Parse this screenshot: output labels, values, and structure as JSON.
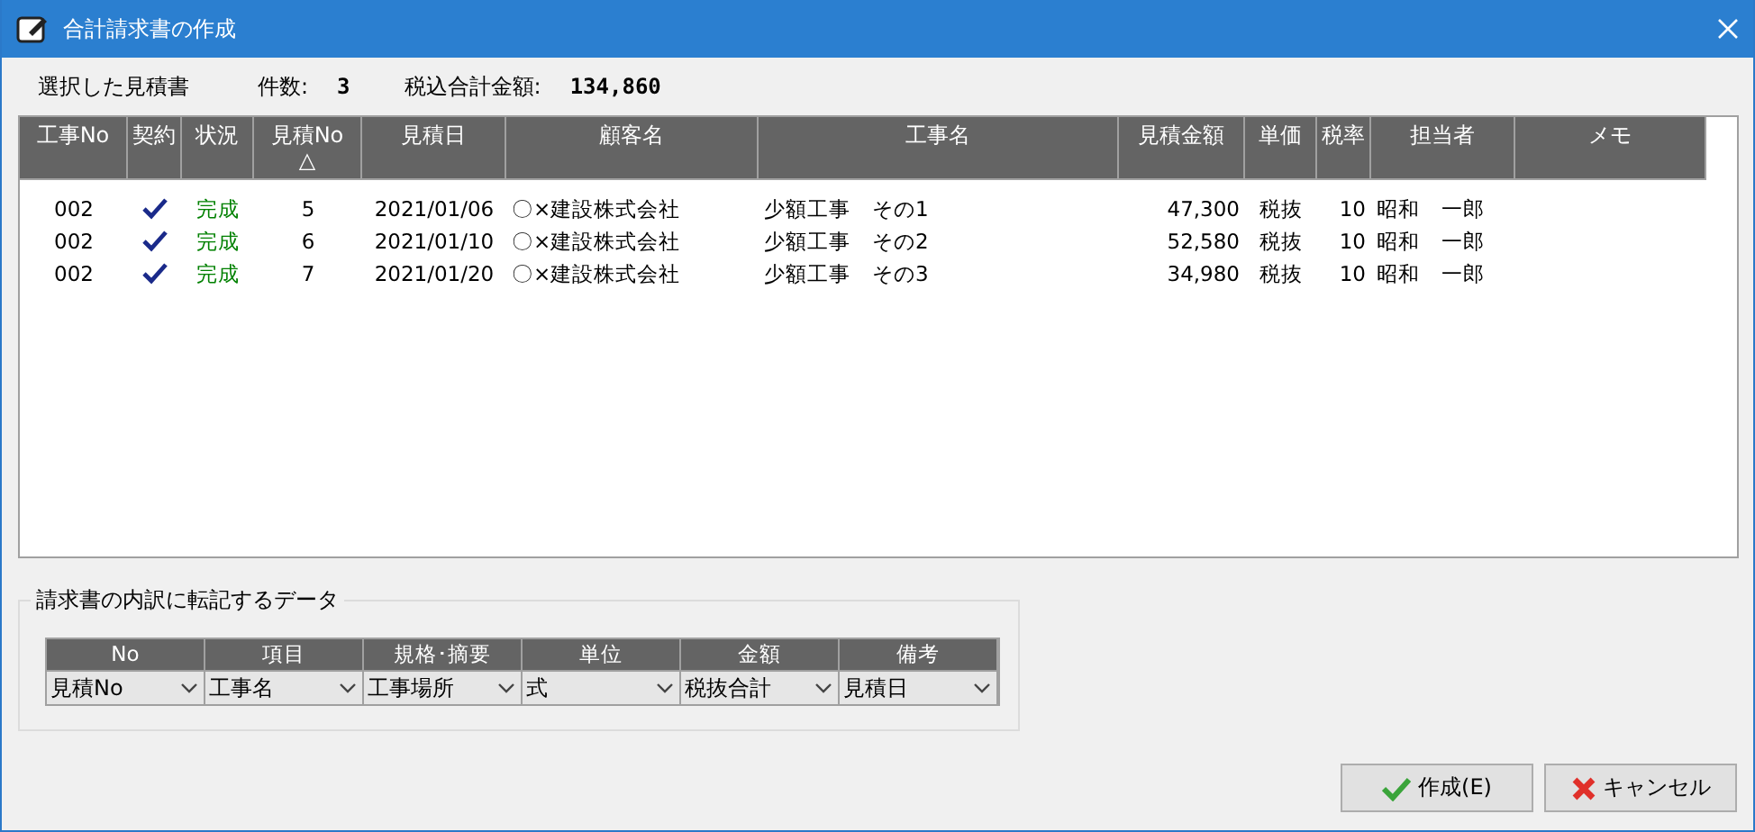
{
  "window": {
    "title": "合計請求書の作成"
  },
  "summary": {
    "label": "選択した見積書",
    "count_label": "件数:",
    "count": "3",
    "total_label": "税込合計金額:",
    "total": "134,860"
  },
  "table": {
    "columns": [
      {
        "label": "工事No"
      },
      {
        "label": "契約"
      },
      {
        "label": "状況"
      },
      {
        "label": "見積No",
        "sort_mark": "△"
      },
      {
        "label": "見積日"
      },
      {
        "label": "顧客名"
      },
      {
        "label": "工事名"
      },
      {
        "label": "見積金額"
      },
      {
        "label": "単価"
      },
      {
        "label": "税率"
      },
      {
        "label": "担当者"
      },
      {
        "label": "メモ"
      }
    ],
    "rows": [
      {
        "koji_no": "002",
        "contract": true,
        "status": "完成",
        "estimate_no": "5",
        "date": "2021/01/06",
        "customer": "〇×建設株式会社",
        "project": "少額工事　その1",
        "amount": "47,300",
        "price_type": "税抜",
        "tax_rate": "10",
        "staff": "昭和　一郎"
      },
      {
        "koji_no": "002",
        "contract": true,
        "status": "完成",
        "estimate_no": "6",
        "date": "2021/01/10",
        "customer": "〇×建設株式会社",
        "project": "少額工事　その2",
        "amount": "52,580",
        "price_type": "税抜",
        "tax_rate": "10",
        "staff": "昭和　一郎"
      },
      {
        "koji_no": "002",
        "contract": true,
        "status": "完成",
        "estimate_no": "7",
        "date": "2021/01/20",
        "customer": "〇×建設株式会社",
        "project": "少額工事　その3",
        "amount": "34,980",
        "price_type": "税抜",
        "tax_rate": "10",
        "staff": "昭和　一郎"
      }
    ]
  },
  "transfer_group": {
    "title": "請求書の内訳に転記するデータ",
    "fields": [
      {
        "label": "No",
        "value": "見積No"
      },
      {
        "label": "項目",
        "value": "工事名"
      },
      {
        "label": "規格･摘要",
        "value": "工事場所"
      },
      {
        "label": "単位",
        "value": "式"
      },
      {
        "label": "金額",
        "value": "税抜合計"
      },
      {
        "label": "備考",
        "value": "見積日"
      }
    ]
  },
  "buttons": [
    {
      "kind": "create",
      "label": "作成(E)"
    },
    {
      "kind": "cancel",
      "label": "キャンセル"
    }
  ]
}
